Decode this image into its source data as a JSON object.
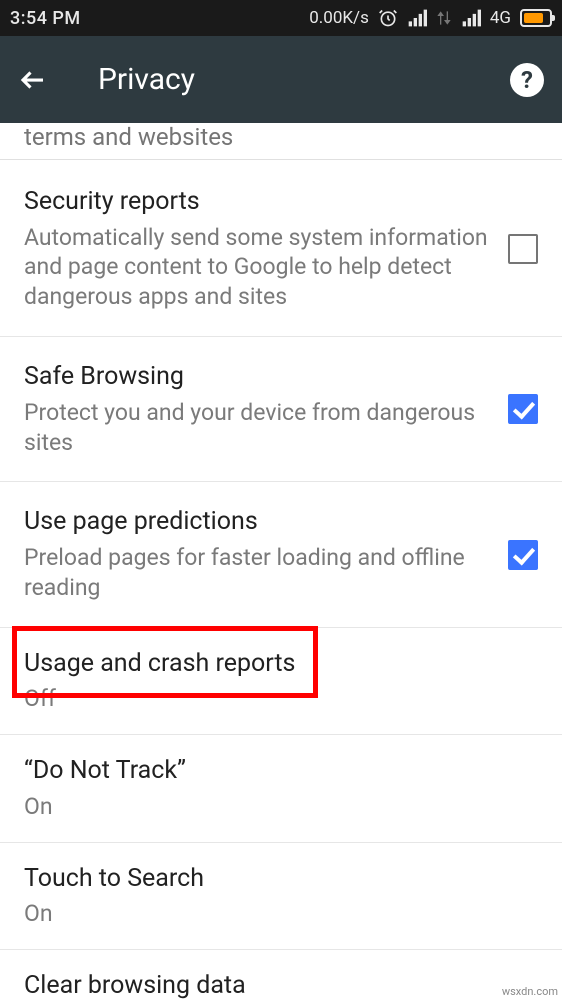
{
  "status": {
    "time": "3:54 PM",
    "speed": "0.00K/s",
    "network": "4G"
  },
  "header": {
    "title": "Privacy"
  },
  "cutoff_text": "terms and websites",
  "items": [
    {
      "title": "Security reports",
      "sub": "Automatically send some system information and page content to Google to help detect dangerous apps and sites",
      "checked": false,
      "hasCheckbox": true
    },
    {
      "title": "Safe Browsing",
      "sub": "Protect you and your device from dangerous sites",
      "checked": true,
      "hasCheckbox": true
    },
    {
      "title": "Use page predictions",
      "sub": "Preload pages for faster loading and offline reading",
      "checked": true,
      "hasCheckbox": true
    },
    {
      "title": "Usage and crash reports",
      "sub": "Off",
      "hasCheckbox": false
    },
    {
      "title": "“Do Not Track”",
      "sub": "On",
      "hasCheckbox": false
    },
    {
      "title": "Touch to Search",
      "sub": "On",
      "hasCheckbox": false
    },
    {
      "title": "Clear browsing data",
      "sub": "",
      "hasCheckbox": false
    }
  ],
  "watermark": "wsxdn.com"
}
